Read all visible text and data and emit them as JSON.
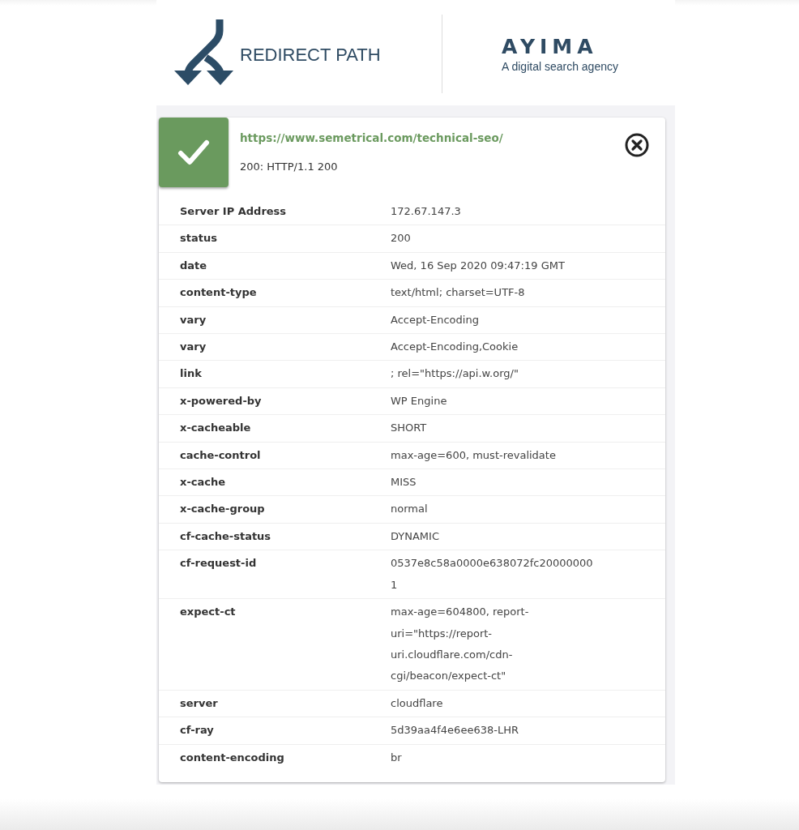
{
  "header": {
    "product_name": "REDIRECT PATH",
    "partner_wordmark": "AYIMA",
    "partner_tagline": "A digital search agency"
  },
  "result": {
    "kind": "success",
    "url": "https://www.semetrical.com/technical-seo/",
    "status_line": "200: HTTP/1.1 200"
  },
  "response_headers": [
    {
      "name": "Server IP Address",
      "value": "172.67.147.3"
    },
    {
      "name": "status",
      "value": "200"
    },
    {
      "name": "date",
      "value": "Wed, 16 Sep 2020 09:47:19 GMT"
    },
    {
      "name": "content-type",
      "value": "text/html; charset=UTF-8"
    },
    {
      "name": "vary",
      "value": "Accept-Encoding"
    },
    {
      "name": "vary",
      "value": "Accept-Encoding,Cookie"
    },
    {
      "name": "link",
      "value": "; rel=\"https://api.w.org/\""
    },
    {
      "name": "x-powered-by",
      "value": "WP Engine"
    },
    {
      "name": "x-cacheable",
      "value": "SHORT"
    },
    {
      "name": "cache-control",
      "value": "max-age=600, must-revalidate"
    },
    {
      "name": "x-cache",
      "value": "MISS"
    },
    {
      "name": "x-cache-group",
      "value": "normal"
    },
    {
      "name": "cf-cache-status",
      "value": "DYNAMIC"
    },
    {
      "name": "cf-request-id",
      "value": "0537e8c58a0000e638072fc200000001"
    },
    {
      "name": "expect-ct",
      "value": "max-age=604800, report-uri=\"https://report-uri.cloudflare.com/cdn-cgi/beacon/expect-ct\""
    },
    {
      "name": "server",
      "value": "cloudflare"
    },
    {
      "name": "cf-ray",
      "value": "5d39aa4f4e6ee638-LHR"
    },
    {
      "name": "content-encoding",
      "value": "br"
    }
  ]
}
